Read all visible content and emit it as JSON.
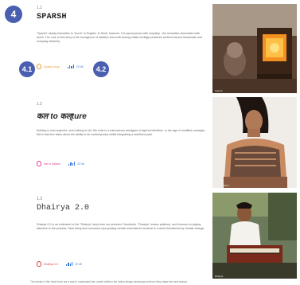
{
  "sections": [
    {
      "number": "1.1",
      "title": "SPARSH",
      "title_mark": "",
      "description": "\"Sparsh\" simply translates to \"touch\" in English. In Hindi, however, it is synonymous with empathy - the sensation associated with touch. The core of this story is the resurgence of tradition and craft among Indian heritage practices centred around handmade and everyday dexterity.",
      "meta_label": "Sparsh story",
      "stat_label": "22:45",
      "badge_main": "4",
      "badge_meta": "4.1",
      "badge_stat": "4.2",
      "photo_caption": "Sparsh"
    },
    {
      "number": "1.2",
      "title": "कल to कल्ture",
      "title_mark": "",
      "description": "Nothing is new anymore, and nothing is old. We exist in a harmonious amalgam of layered identities. In the age of modified nostalgia, fall to that lore takes about the ability to be contemporary whilst integrating a redefined past.",
      "meta_label": "Kal to Kalture",
      "stat_label": "22:45",
      "photo_caption": "Kal to Kalture"
    },
    {
      "number": "1.3",
      "title": "Dhairya 2.0",
      "title_mark": "",
      "description": "Dhairya 2.0 is an extension to the \"Dhairya\" story from our previous Trendbook. \"Dhairya\" means patience, and focuses on paying attention to the process. Slow living and conscious repurposing remain essential for survival in a world threatened by climate change.",
      "meta_label": "Dhairya 2.0",
      "stat_label": "22:45",
      "photo_caption": "Dhairya"
    }
  ],
  "footer_text": "The stories in this trend book are a way to understand the current shifts in the Indian design landscape and how they shape the next season.",
  "colors": {
    "badge": "#4a5fb0",
    "meta1": "#e59a2f",
    "meta2": "#d8408c",
    "meta3": "#d84040",
    "chart": "#3a78d8"
  }
}
